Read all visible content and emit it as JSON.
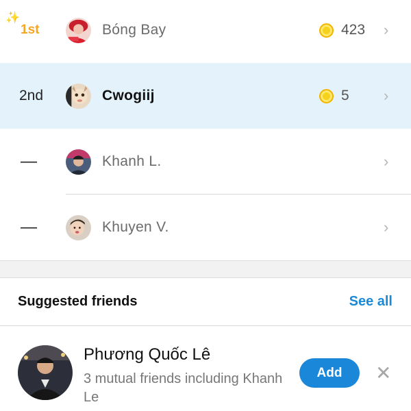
{
  "leaderboard": [
    {
      "rank": "1st",
      "name": "Bóng Bay",
      "points": "423",
      "is_me": false
    },
    {
      "rank": "2nd",
      "name": "Cwogiij",
      "points": "5",
      "is_me": true
    },
    {
      "rank": "—",
      "name": "Khanh L.",
      "points": "",
      "is_me": false
    },
    {
      "rank": "—",
      "name": "Khuyen V.",
      "points": "",
      "is_me": false
    }
  ],
  "icons": {
    "sparkle": "✨",
    "chevron": "›",
    "dismiss": "✕"
  },
  "suggested": {
    "title": "Suggested friends",
    "see_all": "See all",
    "friend": {
      "name": "Phương Quốc Lê",
      "mutual": "3 mutual friends including Khanh Le",
      "add_label": "Add"
    }
  },
  "colors": {
    "accent": "#1b87d9",
    "highlight_row": "#e4f3fb",
    "first_place": "#f5a623",
    "coin": "#f7d21c"
  }
}
